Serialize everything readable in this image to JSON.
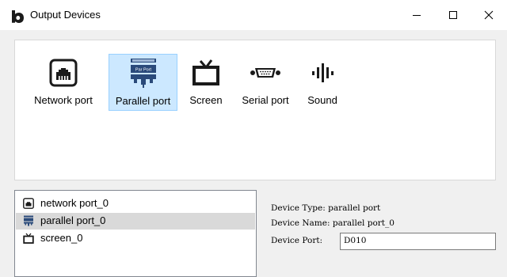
{
  "window": {
    "title": "Output Devices",
    "minimize_symbol": "—",
    "maximize_symbol": "☐",
    "close_symbol": "✕"
  },
  "devices": [
    {
      "label": "Network port",
      "icon": "network-port-icon",
      "selected": false
    },
    {
      "label": "Parallel port",
      "icon": "parallel-port-icon",
      "selected": true,
      "icon_text": "Par Port"
    },
    {
      "label": "Screen",
      "icon": "screen-icon",
      "selected": false
    },
    {
      "label": "Serial port",
      "icon": "serial-port-icon",
      "selected": false
    },
    {
      "label": "Sound",
      "icon": "sound-icon",
      "selected": false
    }
  ],
  "device_list": [
    {
      "label": "network port_0",
      "icon": "network-port-icon",
      "selected": false
    },
    {
      "label": "parallel port_0",
      "icon": "parallel-port-icon",
      "selected": true
    },
    {
      "label": "screen_0",
      "icon": "screen-icon",
      "selected": false
    }
  ],
  "details": {
    "type_label": "Device Type: ",
    "type_value": "parallel port",
    "name_label": "Device Name: ",
    "name_value": "parallel port_0",
    "port_label": "Device Port: ",
    "port_value": "D010"
  },
  "colors": {
    "selection_bg": "#cce8ff",
    "selection_border": "#99d1ff",
    "list_selection_bg": "#d9d9d9",
    "parallel_icon_blue": "#2a4a7a"
  }
}
